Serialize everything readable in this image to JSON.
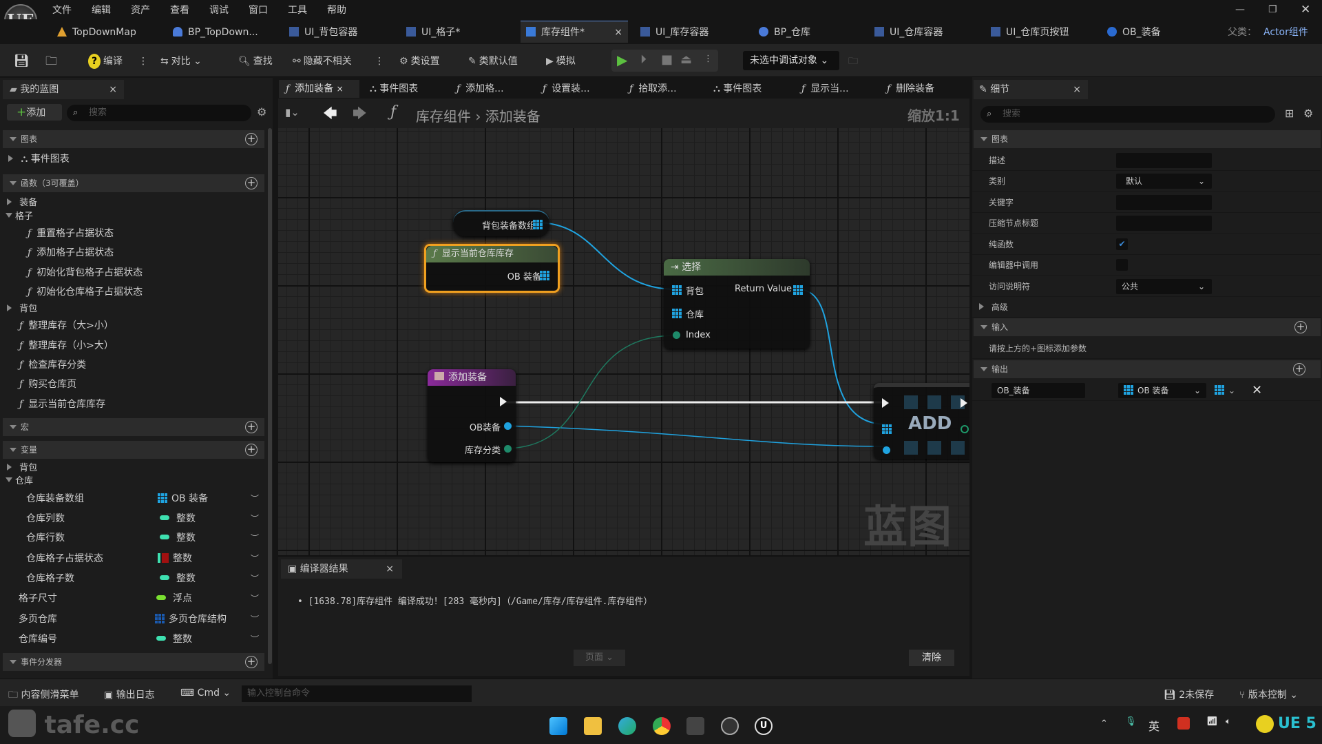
{
  "app": {
    "logo": "UE",
    "parent_label": "父类：",
    "parent_value": "Actor组件"
  },
  "menu": [
    "文件",
    "编辑",
    "资产",
    "查看",
    "调试",
    "窗口",
    "工具",
    "帮助"
  ],
  "window_controls": [
    "minimize",
    "restore",
    "close"
  ],
  "asset_tabs": [
    {
      "label": "TopDownMap",
      "icon": "level-icon",
      "color": "#e0a030"
    },
    {
      "label": "BP_TopDown...",
      "icon": "character-icon",
      "color": "#4a7ad8"
    },
    {
      "label": "UI_背包容器",
      "icon": "widget-icon",
      "color": "#3a5a9a"
    },
    {
      "label": "UI_格子*",
      "icon": "widget-icon",
      "color": "#3a5a9a"
    },
    {
      "label": "库存组件*",
      "icon": "blueprint-icon",
      "color": "#3a7ad8",
      "active": true
    },
    {
      "label": "UI_库存容器",
      "icon": "widget-icon",
      "color": "#3a5a9a"
    },
    {
      "label": "BP_仓库",
      "icon": "actor-icon",
      "color": "#4a7ad8"
    },
    {
      "label": "UI_仓库容器",
      "icon": "widget-icon",
      "color": "#3a5a9a"
    },
    {
      "label": "UI_仓库页按钮",
      "icon": "widget-icon",
      "color": "#3a5a9a"
    },
    {
      "label": "OB_装备",
      "icon": "object-icon",
      "color": "#2a6ad0"
    }
  ],
  "toolbar": {
    "compile": "编译",
    "diff": "对比",
    "find": "查找",
    "hide_unrelated": "隐藏不相关",
    "class_settings": "类设置",
    "class_defaults": "类默认值",
    "simulate": "模拟",
    "debug_target": "未选中调试对象"
  },
  "my_blueprint": {
    "tab": "我的蓝图",
    "add": "添加",
    "search_placeholder": "搜索",
    "graphs": {
      "header": "图表",
      "items": [
        "事件图表"
      ]
    },
    "functions": {
      "header": "函数（3可覆盖）",
      "groups": [
        {
          "label": "装备",
          "expanded": false
        },
        {
          "label": "格子",
          "expanded": true,
          "items": [
            "重置格子占据状态",
            "添加格子占据状态",
            "初始化背包格子占据状态",
            "初始化仓库格子占据状态"
          ]
        },
        {
          "label": "背包",
          "expanded": false
        }
      ],
      "items": [
        "整理库存（大>小）",
        "整理库存（小>大）",
        "检查库存分类",
        "购买仓库页",
        "显示当前仓库库存"
      ]
    },
    "macros": {
      "header": "宏"
    },
    "variables": {
      "header": "变量",
      "groups": [
        {
          "label": "背包",
          "expanded": false
        },
        {
          "label": "仓库",
          "expanded": true,
          "items": [
            {
              "name": "仓库装备数组",
              "type": "OB 装备",
              "kind": "array",
              "color": "#1fa3e0"
            },
            {
              "name": "仓库列数",
              "type": "整数",
              "kind": "single",
              "color": "#3ee0b0"
            },
            {
              "name": "仓库行数",
              "type": "整数",
              "kind": "single",
              "color": "#3ee0b0"
            },
            {
              "name": "仓库格子占据状态",
              "type": "整数",
              "kind": "map",
              "color": "#3ee0b0"
            },
            {
              "name": "仓库格子数",
              "type": "整数",
              "kind": "single",
              "color": "#3ee0b0"
            }
          ]
        }
      ],
      "items": [
        {
          "name": "格子尺寸",
          "type": "浮点",
          "kind": "single",
          "color": "#7ae030"
        },
        {
          "name": "多页仓库",
          "type": "多页仓库结构",
          "kind": "array",
          "color": "#1a5ab0"
        },
        {
          "name": "仓库编号",
          "type": "整数",
          "kind": "single",
          "color": "#3ee0b0"
        }
      ]
    },
    "dispatchers": {
      "header": "事件分发器"
    }
  },
  "doc_tabs": [
    {
      "label": "添加装备",
      "icon": "function-icon",
      "active": true
    },
    {
      "label": "事件图表",
      "icon": "graph-icon"
    },
    {
      "label": "添加格...",
      "icon": "function-icon"
    },
    {
      "label": "设置装...",
      "icon": "function-icon"
    },
    {
      "label": "拾取添...",
      "icon": "function-icon"
    },
    {
      "label": "事件图表",
      "icon": "graph-icon"
    },
    {
      "label": "显示当...",
      "icon": "function-icon"
    },
    {
      "label": "删除装备",
      "icon": "function-icon"
    }
  ],
  "breadcrumb": {
    "root": "库存组件",
    "current": "添加装备"
  },
  "zoom_label": "缩放1:1",
  "watermark": "蓝图",
  "nodes": {
    "var_node": {
      "label": "背包装备数组"
    },
    "func_node": {
      "title": "显示当前仓库库存",
      "output": "OB 装备"
    },
    "select_node": {
      "title": "选择",
      "inputs": [
        "背包",
        "仓库",
        "Index"
      ],
      "output": "Return Value"
    },
    "entry_node": {
      "title": "添加装备",
      "outputs": [
        "OB装备",
        "库存分类"
      ]
    },
    "add_node": {
      "title": "ADD"
    }
  },
  "compiler": {
    "tab": "编译器结果",
    "message": "[1638.78]库存组件 编译成功！[283 毫秒内]（/Game/库存/库存组件.库存组件）",
    "page": "页面",
    "clear": "清除"
  },
  "details": {
    "tab": "细节",
    "search_placeholder": "搜索",
    "graph_section": "图表",
    "rows": [
      {
        "label": "描述",
        "value": ""
      },
      {
        "label": "类别",
        "value": "默认"
      },
      {
        "label": "关键字",
        "value": ""
      },
      {
        "label": "压缩节点标题",
        "value": ""
      },
      {
        "label": "纯函数",
        "checked": true
      },
      {
        "label": "编辑器中调用",
        "checked": false
      },
      {
        "label": "访问说明符",
        "value": "公共"
      }
    ],
    "advanced": "高级",
    "inputs_section": "输入",
    "inputs_hint": "请按上方的+图标添加参数",
    "outputs_section": "输出",
    "output_param": {
      "name": "OB_装备",
      "type": "OB 装备"
    }
  },
  "statusbar": {
    "content_drawer": "内容侧滑菜单",
    "output_log": "输出日志",
    "cmd": "Cmd",
    "console_placeholder": "输入控制台命令",
    "unsaved": "2未保存",
    "source_control": "版本控制"
  },
  "taskbar": {
    "watermark": "tafe.cc",
    "ime": "英",
    "ue_label": "UE 5"
  }
}
